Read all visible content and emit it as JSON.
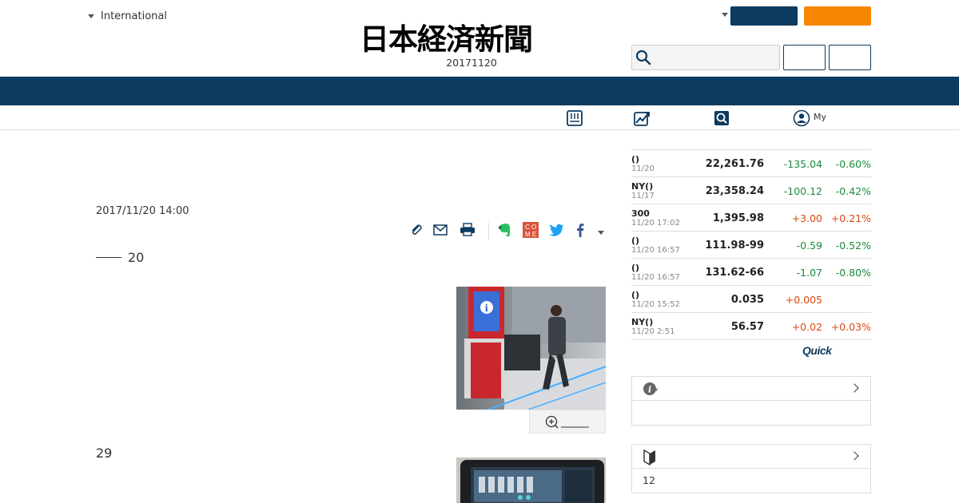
{
  "header": {
    "region_label": "International",
    "logo_text": "日本経済新聞",
    "paper_date": "20171120"
  },
  "subnav": {
    "my_label": "My"
  },
  "article": {
    "pubdate": "2017/11/20 14:00",
    "series_num": "20",
    "para_num": "29"
  },
  "market": {
    "rows": [
      {
        "name": "()",
        "time": "11/20",
        "value": "22,261.76",
        "change": "-135.04",
        "pct": "-0.60%",
        "dir": "neg"
      },
      {
        "name": "NY()",
        "time": "11/17",
        "value": "23,358.24",
        "change": "-100.12",
        "pct": "-0.42%",
        "dir": "neg"
      },
      {
        "name": "300",
        "time": "11/20 17:02",
        "value": "1,395.98",
        "change": "+3.00",
        "pct": "+0.21%",
        "dir": "pos"
      },
      {
        "name": "()",
        "time": "11/20 16:57",
        "value": "111.98-99",
        "change": "-0.59",
        "pct": "-0.52%",
        "dir": "neg"
      },
      {
        "name": "()",
        "time": "11/20 16:57",
        "value": "131.62-66",
        "change": "-1.07",
        "pct": "-0.80%",
        "dir": "neg"
      },
      {
        "name": "()",
        "time": "11/20 15:52",
        "value": "0.035",
        "change": "+0.005",
        "pct": "",
        "dir": "pos"
      },
      {
        "name": "NY()",
        "time": "11/20 2:51",
        "value": "56.57",
        "change": "+0.02",
        "pct": "+0.03%",
        "dir": "pos"
      }
    ],
    "provider": "Quick"
  },
  "info_box": {
    "body": ""
  },
  "beginner_box": {
    "body": "12"
  },
  "colors": {
    "navy": "#0d3a5f",
    "orange": "#f58800",
    "negative": "#1a8a3a",
    "positive": "#d9480f"
  }
}
